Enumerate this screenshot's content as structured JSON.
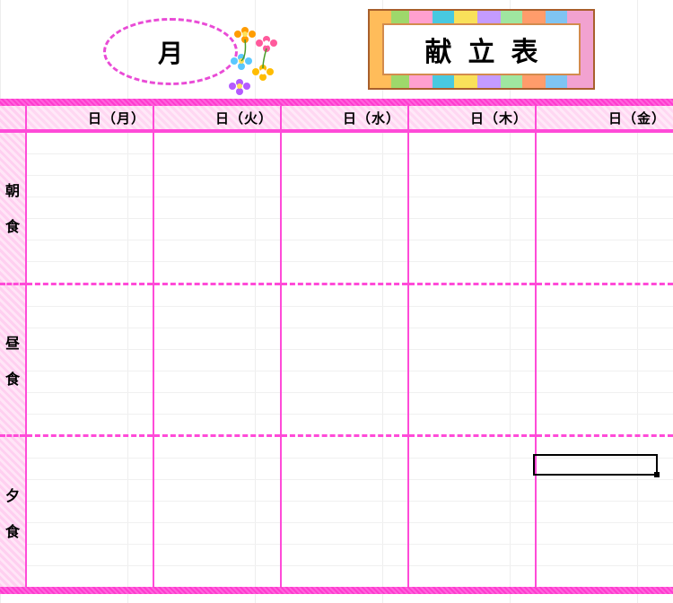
{
  "title": "献立表",
  "month_label": "月",
  "day_headers": [
    "日（月）",
    "日（火）",
    "日（水）",
    "日（木）",
    "日（金）"
  ],
  "meal_rows": [
    {
      "char1": "朝",
      "char2": "食"
    },
    {
      "char1": "昼",
      "char2": "食"
    },
    {
      "char1": "夕",
      "char2": "食"
    }
  ]
}
